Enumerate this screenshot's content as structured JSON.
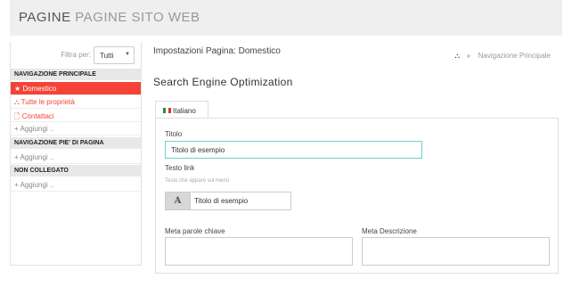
{
  "header": {
    "title_bold": "PAGINE",
    "title_light": "PAGINE SITO WEB"
  },
  "sidebar": {
    "filter_label": "Filtra per:",
    "filter_value": "Tutti",
    "sections": [
      {
        "title": "NAVIGAZIONE PRINCIPALE"
      },
      {
        "title": "NAVIGAZIONE PIE' DI PAGINA"
      },
      {
        "title": "NON COLLEGATO"
      }
    ],
    "items": {
      "domestico": "★ Domestico",
      "tutte": "⛬ Tutte le proprietà",
      "contattaci": "🗋 Contattaci",
      "aggiungi1": "+ Aggiungi ..",
      "aggiungi2": "+ Aggiungi ..",
      "aggiungi3": "+ Aggiungi .."
    }
  },
  "main": {
    "breadcrumb_title": "Impostazioni Pagina: Domestico",
    "breadcrumb_icon": "⛬",
    "breadcrumb_chev": "▸",
    "breadcrumb_target": "Navigazione Principale",
    "section_title": "Search Engine Optimization",
    "tab_label": "Italiano",
    "fields": {
      "titolo_label": "Titolo",
      "titolo_value": "Titolo di esempio",
      "testo_link_label": "Testo link",
      "testo_link_help": "Testo che appare sul menù",
      "testo_link_addon": "A",
      "testo_link_value": "Titolo di esempio",
      "meta_keywords_label": "Meta parole chiave",
      "meta_desc_label": "Meta Descrizione"
    }
  }
}
